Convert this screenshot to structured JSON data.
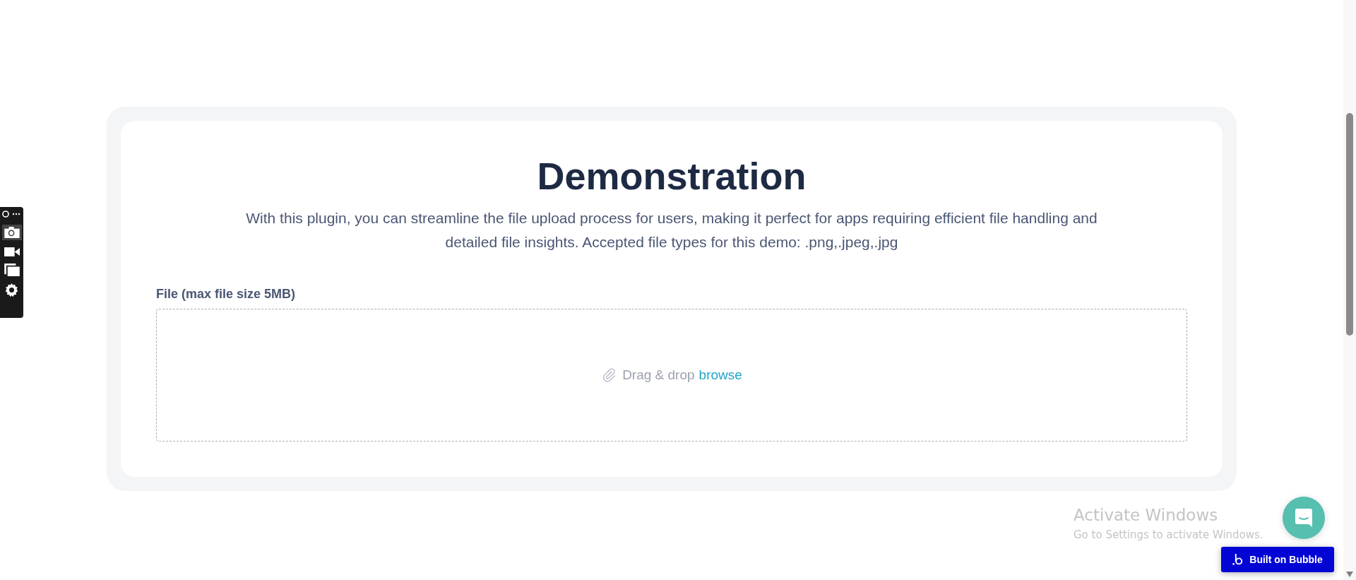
{
  "title": "Demonstration",
  "description": "With this plugin, you can streamline the file upload process for users, making it perfect for apps requiring efficient file handling and detailed file insights. Accepted file types for this demo: .png,.jpeg,.jpg",
  "upload": {
    "label": "File (max file size 5MB)",
    "prompt": "Drag & drop",
    "link": "browse"
  },
  "os_notice": {
    "title": "Activate Windows",
    "subtitle": "Go to Settings to activate Windows."
  },
  "badge": {
    "label": "Built on Bubble"
  }
}
